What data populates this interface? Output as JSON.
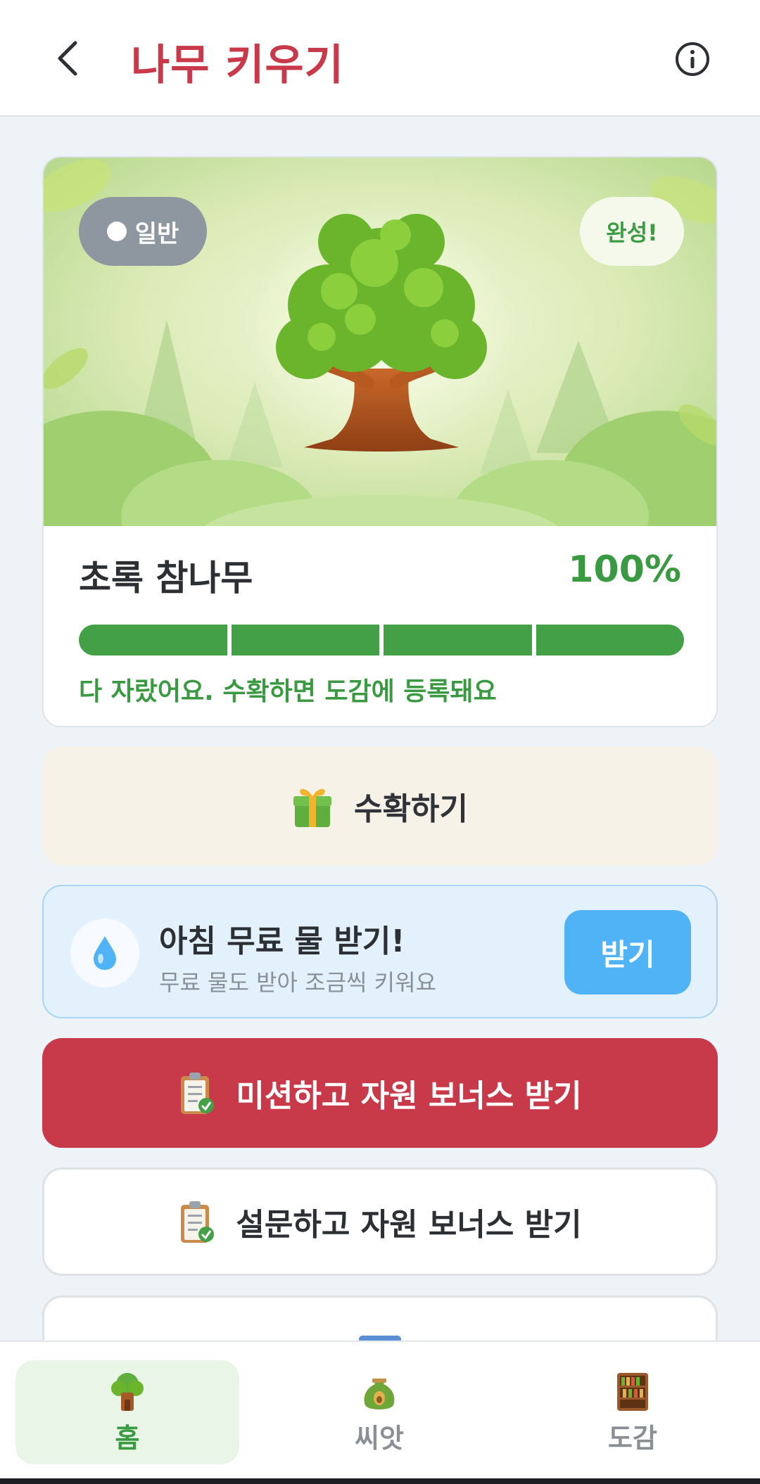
{
  "header": {
    "title": "나무 키우기",
    "back_icon": "chevron-left-icon",
    "info_icon": "info-icon"
  },
  "tree_card": {
    "grade_label": "일반",
    "status_label": "완성!",
    "tree_name": "초록 참나무",
    "progress_text": "100%",
    "progress_value": 1.0,
    "progress_segments": 4,
    "message": "다 자랐어요. 수확하면 도감에 등록돼요"
  },
  "harvest": {
    "label": "수확하기",
    "icon": "gift-icon"
  },
  "water": {
    "title": "아침 무료 물 받기!",
    "subtitle": "무료 물도 받아 조금씩 키워요",
    "button_label": "받기",
    "icon": "water-drop-icon"
  },
  "mission": {
    "label": "미션하고 자원 보너스 받기",
    "icon": "clipboard-icon"
  },
  "survey": {
    "label": "설문하고 자원 보너스 받기",
    "icon": "clipboard-icon"
  },
  "nav": {
    "items": [
      {
        "label": "홈",
        "icon": "tree-house-icon",
        "active": true
      },
      {
        "label": "씨앗",
        "icon": "seed-bag-icon",
        "active": false
      },
      {
        "label": "도감",
        "icon": "bookshelf-icon",
        "active": false
      }
    ]
  },
  "colors": {
    "brand": "#c83a4a",
    "green": "#43a047",
    "blue": "#4fb3f5"
  }
}
